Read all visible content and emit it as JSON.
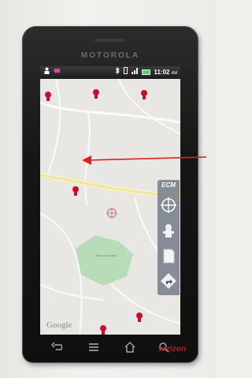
{
  "device": {
    "brand": "MOTOROLA",
    "carrier": "verizon"
  },
  "status_bar": {
    "time": "11:02",
    "ampm": "AM",
    "icons_left": [
      "person-icon",
      "butterfly-icon"
    ],
    "icons_right": [
      "bluetooth-icon",
      "vibrate-icon",
      "signal-icon",
      "battery-icon"
    ]
  },
  "map": {
    "attribution": "Google",
    "park_label": "Patriot County Park",
    "center_target": "crosshair-target-icon",
    "hydrant_count": 5
  },
  "toolbar": {
    "ecm_label": "ECM",
    "buttons": [
      "crosshair-icon",
      "hydrant-icon",
      "page-icon",
      "directions-icon"
    ]
  },
  "nav_bar": [
    "back-icon",
    "menu-icon",
    "home-icon",
    "search-icon"
  ],
  "colors": {
    "arrow": "#e02020",
    "hydrant": "#c8102e",
    "park": "#b7dcb7",
    "toolbar": "#7a8290"
  }
}
